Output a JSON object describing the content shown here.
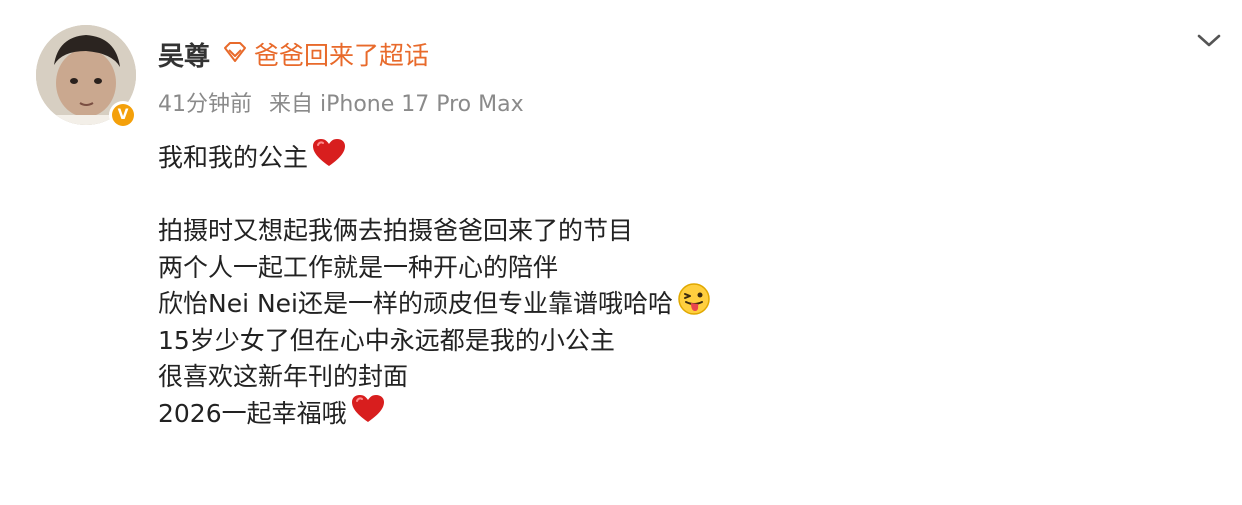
{
  "post": {
    "author": {
      "name": "吴尊",
      "avatar_icon": "child-portrait-avatar",
      "verified_badge": "V"
    },
    "supertopic": {
      "icon": "diamond-icon",
      "label": "爸爸回来了超话"
    },
    "meta": {
      "time": "41分钟前",
      "source": "来自 iPhone 17 Pro Max"
    },
    "menu_icon": "chevron-down-icon",
    "lines": [
      {
        "text": "我和我的公主",
        "emoji": "red-heart"
      },
      {
        "text": "",
        "emoji": ""
      },
      {
        "text": "拍摄时又想起我俩去拍摄爸爸回来了的节目",
        "emoji": ""
      },
      {
        "text": "两个人一起工作就是一种开心的陪伴",
        "emoji": ""
      },
      {
        "text": "欣怡Nei Nei还是一样的顽皮但专业靠谱哦哈哈",
        "emoji": "tongue-out-face"
      },
      {
        "text": "15岁少女了但在心中永远都是我的小公主",
        "emoji": ""
      },
      {
        "text": "很喜欢这新年刊的封面",
        "emoji": ""
      },
      {
        "text": "2026一起幸福哦",
        "emoji": "red-heart"
      }
    ],
    "colors": {
      "supertopic": "#e86a2b",
      "meta": "#8a8a8a",
      "badge": "#f4a00a",
      "heart": "#d81e1e"
    }
  }
}
